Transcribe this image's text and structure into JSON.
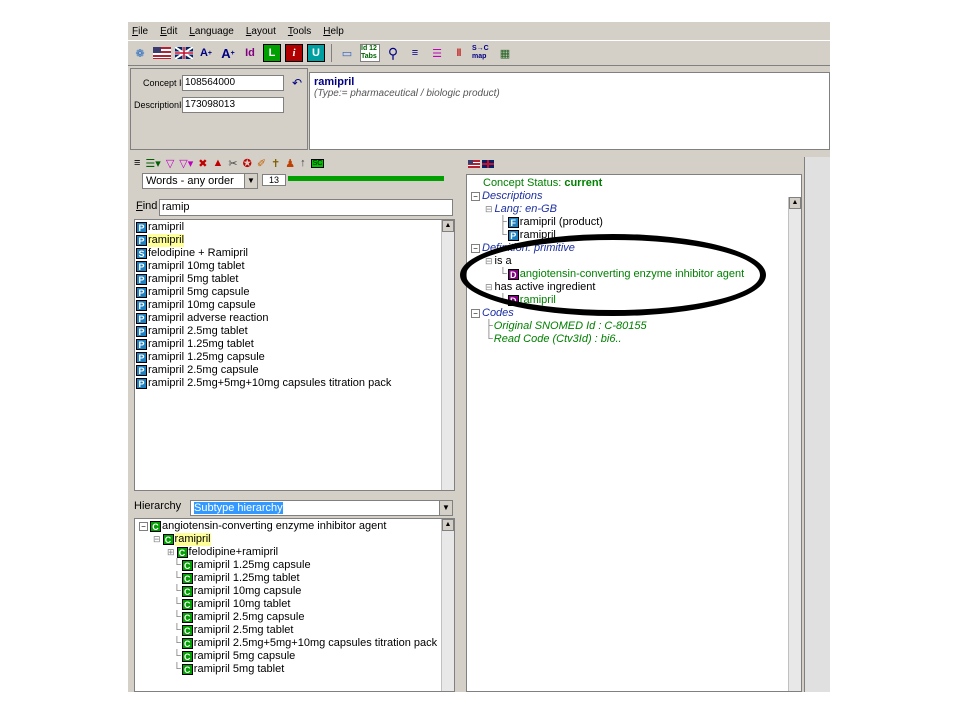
{
  "menu": [
    {
      "label": "File",
      "u": "F",
      "rest": "ile"
    },
    {
      "label": "Edit",
      "u": "E",
      "rest": "dit"
    },
    {
      "label": "Language",
      "u": "L",
      "rest": "anguage"
    },
    {
      "label": "Layout",
      "u": "L",
      "rest": "ayout"
    },
    {
      "label": "Tools",
      "u": "T",
      "rest": "ools"
    },
    {
      "label": "Help",
      "u": "H",
      "rest": "elp"
    }
  ],
  "toolbar": {
    "font_up": "A",
    "font_down": "A",
    "id_label": "Id",
    "id_tabs_label": "Id 12 Tabs",
    "map_label": "S→C map"
  },
  "concept": {
    "concept_id_label": "Concept Id",
    "concept_id": "108564000",
    "description_id_label": "DescriptionId",
    "description_id": "173098013",
    "preferred_term": "ramipril",
    "type_text": "(Type:= pharmaceutical / biologic product)"
  },
  "search": {
    "order_option": "Words - any order",
    "results_count": "13",
    "find_label": "Find",
    "find_value": "ramip"
  },
  "results": [
    {
      "type": "P",
      "text": "ramipril",
      "highlight": false
    },
    {
      "type": "P",
      "text": "ramipril",
      "highlight": true
    },
    {
      "type": "S",
      "text": "felodipine + Ramipril",
      "highlight": false
    },
    {
      "type": "P",
      "text": "ramipril 10mg tablet",
      "highlight": false
    },
    {
      "type": "P",
      "text": "ramipril 5mg tablet",
      "highlight": false
    },
    {
      "type": "P",
      "text": "ramipril 5mg capsule",
      "highlight": false
    },
    {
      "type": "P",
      "text": "ramipril 10mg capsule",
      "highlight": false
    },
    {
      "type": "P",
      "text": "ramipril adverse reaction",
      "highlight": false
    },
    {
      "type": "P",
      "text": "ramipril 2.5mg tablet",
      "highlight": false
    },
    {
      "type": "P",
      "text": "ramipril 1.25mg tablet",
      "highlight": false
    },
    {
      "type": "P",
      "text": "ramipril 1.25mg capsule",
      "highlight": false
    },
    {
      "type": "P",
      "text": "ramipril 2.5mg capsule",
      "highlight": false
    },
    {
      "type": "P",
      "text": "ramipril 2.5mg+5mg+10mg capsules titration pack",
      "highlight": false
    }
  ],
  "hierarchy": {
    "label": "Hierarchy",
    "option": "Subtype hierarchy",
    "parent": "angiotensin-converting enzyme inhibitor agent",
    "current": "ramipril",
    "children": [
      "felodipine+ramipril",
      "ramipril 1.25mg capsule",
      "ramipril 1.25mg tablet",
      "ramipril 10mg capsule",
      "ramipril 10mg tablet",
      "ramipril 2.5mg capsule",
      "ramipril 2.5mg tablet",
      "ramipril 2.5mg+5mg+10mg capsules titration pack",
      "ramipril 5mg capsule",
      "ramipril 5mg tablet"
    ]
  },
  "details": {
    "status_label": "Concept Status:",
    "status_value": "current",
    "descriptions_label": "Descriptions",
    "lang_label": "Lang: en-GB",
    "fsn": "ramipril (product)",
    "preferred": "ramipril",
    "definition_label": "Definition: primitive",
    "is_a_label": "is a",
    "is_a_target": "angiotensin-converting enzyme inhibitor agent",
    "has_active_label": "has active ingredient",
    "has_active_target": "ramipril",
    "codes_label": "Codes",
    "snomed_id": "Original SNOMED Id : C-80155",
    "read_code": "Read Code (Ctv3Id) : bi6.."
  },
  "colors": {
    "blue_term": "#1c2fa3",
    "green_term": "#008000",
    "p_badge": "#1f7fbf",
    "c_badge": "#00a000",
    "d_badge": "#800080"
  }
}
